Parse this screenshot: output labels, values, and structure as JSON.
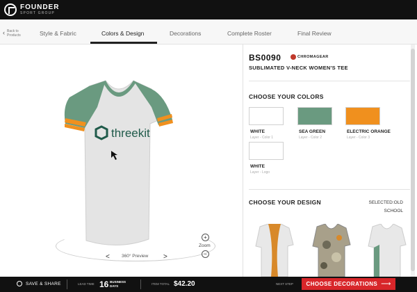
{
  "brand": {
    "name": "FOUNDER",
    "sub": "SPORT GROUP"
  },
  "nav": {
    "back_label": "Back to Products",
    "tabs": [
      "Style & Fabric",
      "Colors & Design",
      "Decorations",
      "Complete Roster",
      "Final Review"
    ],
    "active_tab": "Colors & Design"
  },
  "preview": {
    "label": "360° Preview",
    "zoom_label": "Zoom",
    "zoom_in": "+",
    "zoom_out": "−",
    "prev": "<",
    "next": ">",
    "tee_logo_text": "threekit",
    "colors": {
      "body": "#e4e4e4",
      "sleeve": "#6a9a80",
      "stripe": "#f0901e",
      "logo": "#1f5a4a"
    }
  },
  "product": {
    "sku": "BS0090",
    "partner_logo_text": "CHROMAGEAR",
    "name": "SUBLIMATED V-NECK WOMEN'S TEE"
  },
  "colors_section": {
    "title": "CHOOSE YOUR COLORS",
    "swatches": [
      {
        "name": "WHITE",
        "layer": "Layer - Color 1",
        "color": "#ffffff"
      },
      {
        "name": "SEA GREEN",
        "layer": "Layer - Color 2",
        "color": "#6a9a80"
      },
      {
        "name": "ELECTRIC ORANGE",
        "layer": "Layer - Color 3",
        "color": "#f0901e"
      },
      {
        "name": "WHITE",
        "layer": "Layer - Logo",
        "color": "#ffffff"
      }
    ]
  },
  "design_section": {
    "title": "CHOOSE YOUR DESIGN",
    "selected_label": "SELECTED:OLD SCHOOL",
    "thumb_colors": [
      "#e8e8e8",
      "#d8892a",
      "#a8a08a",
      "#6a9a80"
    ]
  },
  "footer": {
    "save_label": "SAVE & SHARE",
    "lead_label": "LEAD TIME",
    "lead_num": "16",
    "lead_unit": "BUSINESS DAYS",
    "total_label": "ITEM TOTAL",
    "total_value": "$42.20",
    "next_label": "NEXT STEP",
    "cta_label": "CHOOSE DECORATIONS",
    "cta_arrow": "⟶",
    "cta_color": "#d8262a"
  }
}
